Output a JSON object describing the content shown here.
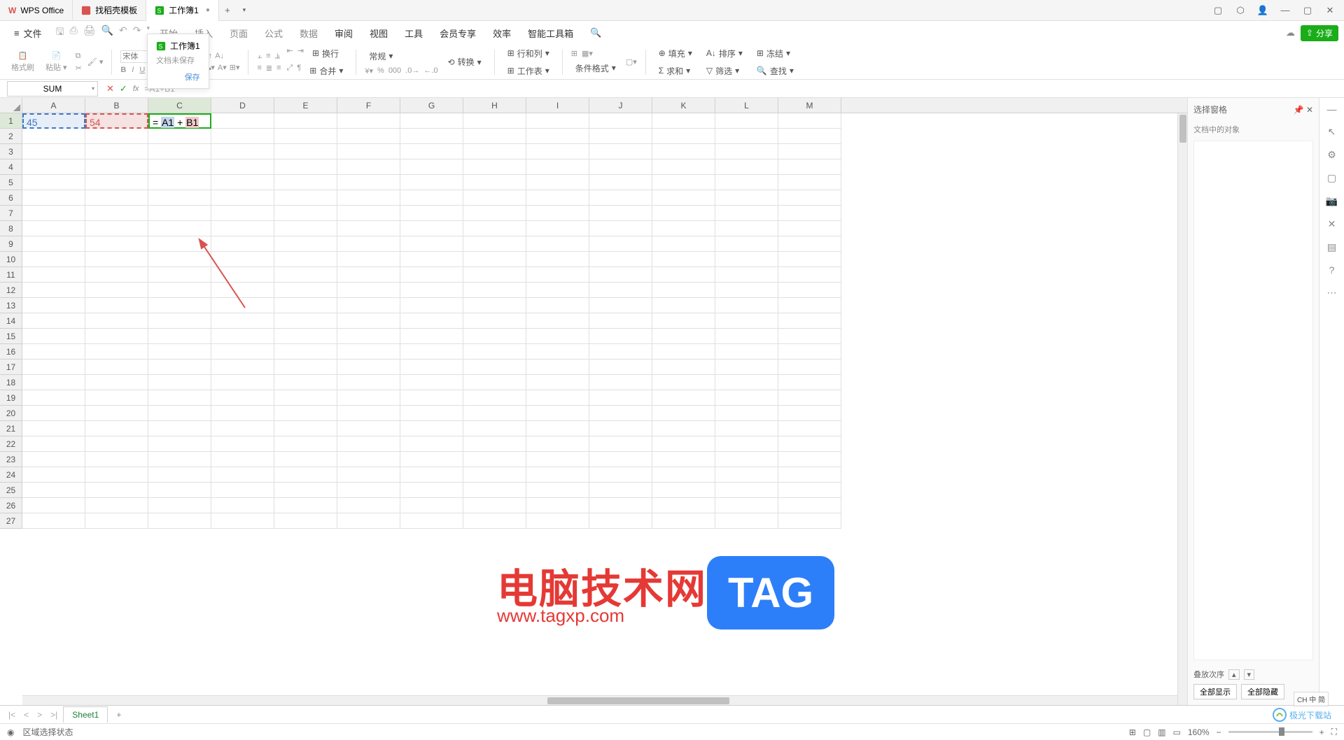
{
  "titlebar": {
    "app_name": "WPS Office",
    "tabs": [
      {
        "label": "找稻壳模板",
        "icon_color": "#d9534f"
      },
      {
        "label": "工作簿1",
        "icon_color": "#1aad19",
        "active": true
      }
    ]
  },
  "tooltip": {
    "title": "工作簿1",
    "subtitle": "文档未保存",
    "save_text": "保存"
  },
  "menubar": {
    "file_label": "文件",
    "items_light": [
      "开始",
      "插入",
      "页面",
      "公式",
      "数据"
    ],
    "items_dark": [
      "审阅",
      "视图",
      "工具",
      "会员专享",
      "效率",
      "智能工具箱"
    ],
    "share_label": "分享"
  },
  "ribbon": {
    "format_brush": "格式刷",
    "paste": "粘贴",
    "font_placeholder": "宋体",
    "bold": "B",
    "italic": "I",
    "underline": "U",
    "wrap": "换行",
    "merge": "合并",
    "general": "常规",
    "convert": "转换",
    "rowcol": "行和列",
    "worksheet": "工作表",
    "cond_format": "条件格式",
    "fill": "填充",
    "sort": "排序",
    "sum": "求和",
    "filter": "筛选",
    "freeze": "冻结",
    "find": "查找"
  },
  "formula_bar": {
    "name_box": "SUM",
    "formula_text": "=A1+B1"
  },
  "grid": {
    "columns": [
      "A",
      "B",
      "C",
      "D",
      "E",
      "F",
      "G",
      "H",
      "I",
      "J",
      "K",
      "L",
      "M"
    ],
    "active_col": "C",
    "row_count": 27,
    "active_row": 1,
    "cells": {
      "A1": "45",
      "B1": "54",
      "C1_prefix": "=",
      "C1_ref1": "A1",
      "C1_op": "+",
      "C1_ref2": "B1"
    }
  },
  "sidebar": {
    "title": "选择窗格",
    "subtitle": "文档中的对象",
    "stacking": "叠放次序",
    "show_all": "全部显示",
    "hide_all": "全部隐藏"
  },
  "sheet_tabs": {
    "active": "Sheet1"
  },
  "statusbar": {
    "mode": "区域选择状态",
    "zoom": "160%"
  },
  "watermark": {
    "title": "电脑技术网",
    "url": "www.tagxp.com",
    "tag": "TAG",
    "jg": "极光下载站"
  },
  "lang": "CH 中 简"
}
